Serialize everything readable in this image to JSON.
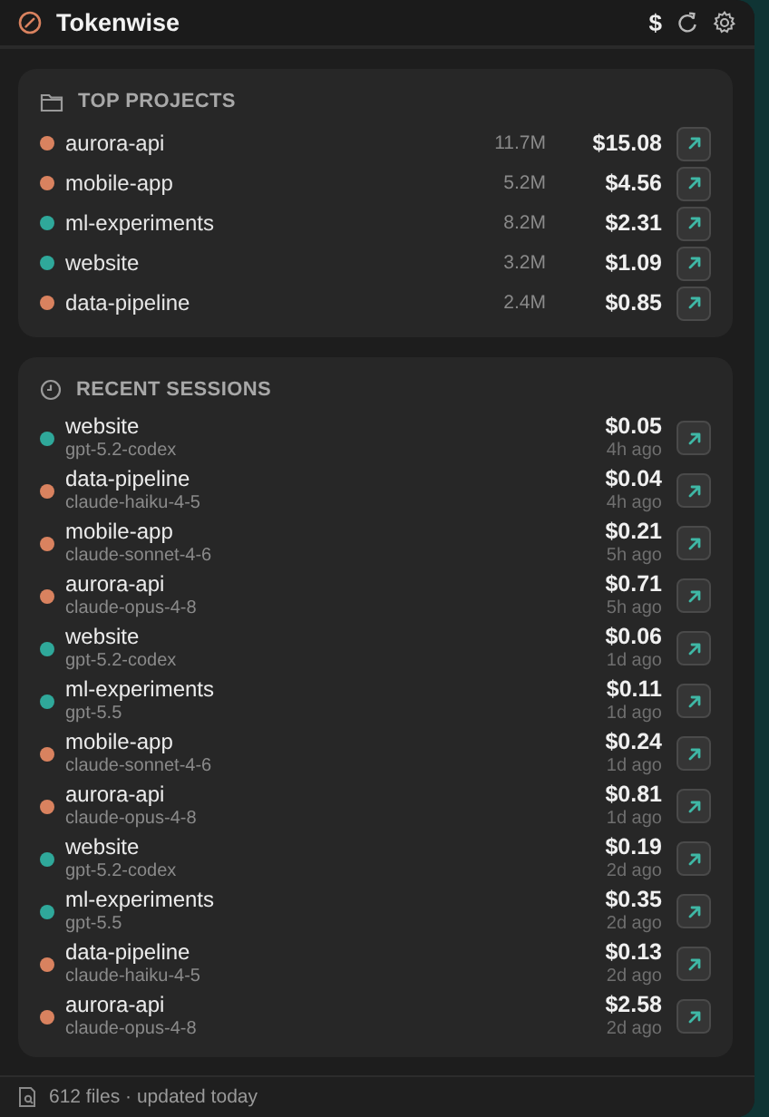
{
  "header": {
    "title": "Tokenwise",
    "currency_symbol": "$"
  },
  "top_projects": {
    "title": "TOP PROJECTS",
    "items": [
      {
        "name": "aurora-api",
        "tokens": "11.7M",
        "cost": "$15.08",
        "color": "#d9825f"
      },
      {
        "name": "mobile-app",
        "tokens": "5.2M",
        "cost": "$4.56",
        "color": "#d9825f"
      },
      {
        "name": "ml-experiments",
        "tokens": "8.2M",
        "cost": "$2.31",
        "color": "#2fa89a"
      },
      {
        "name": "website",
        "tokens": "3.2M",
        "cost": "$1.09",
        "color": "#2fa89a"
      },
      {
        "name": "data-pipeline",
        "tokens": "2.4M",
        "cost": "$0.85",
        "color": "#d9825f"
      }
    ]
  },
  "recent_sessions": {
    "title": "RECENT SESSIONS",
    "items": [
      {
        "project": "website",
        "model": "gpt-5.2-codex",
        "cost": "$0.05",
        "time": "4h ago",
        "color": "#2fa89a"
      },
      {
        "project": "data-pipeline",
        "model": "claude-haiku-4-5",
        "cost": "$0.04",
        "time": "4h ago",
        "color": "#d9825f"
      },
      {
        "project": "mobile-app",
        "model": "claude-sonnet-4-6",
        "cost": "$0.21",
        "time": "5h ago",
        "color": "#d9825f"
      },
      {
        "project": "aurora-api",
        "model": "claude-opus-4-8",
        "cost": "$0.71",
        "time": "5h ago",
        "color": "#d9825f"
      },
      {
        "project": "website",
        "model": "gpt-5.2-codex",
        "cost": "$0.06",
        "time": "1d ago",
        "color": "#2fa89a"
      },
      {
        "project": "ml-experiments",
        "model": "gpt-5.5",
        "cost": "$0.11",
        "time": "1d ago",
        "color": "#2fa89a"
      },
      {
        "project": "mobile-app",
        "model": "claude-sonnet-4-6",
        "cost": "$0.24",
        "time": "1d ago",
        "color": "#d9825f"
      },
      {
        "project": "aurora-api",
        "model": "claude-opus-4-8",
        "cost": "$0.81",
        "time": "1d ago",
        "color": "#d9825f"
      },
      {
        "project": "website",
        "model": "gpt-5.2-codex",
        "cost": "$0.19",
        "time": "2d ago",
        "color": "#2fa89a"
      },
      {
        "project": "ml-experiments",
        "model": "gpt-5.5",
        "cost": "$0.35",
        "time": "2d ago",
        "color": "#2fa89a"
      },
      {
        "project": "data-pipeline",
        "model": "claude-haiku-4-5",
        "cost": "$0.13",
        "time": "2d ago",
        "color": "#d9825f"
      },
      {
        "project": "aurora-api",
        "model": "claude-opus-4-8",
        "cost": "$2.58",
        "time": "2d ago",
        "color": "#d9825f"
      }
    ]
  },
  "status_bar": {
    "text": "612 files · updated today"
  }
}
